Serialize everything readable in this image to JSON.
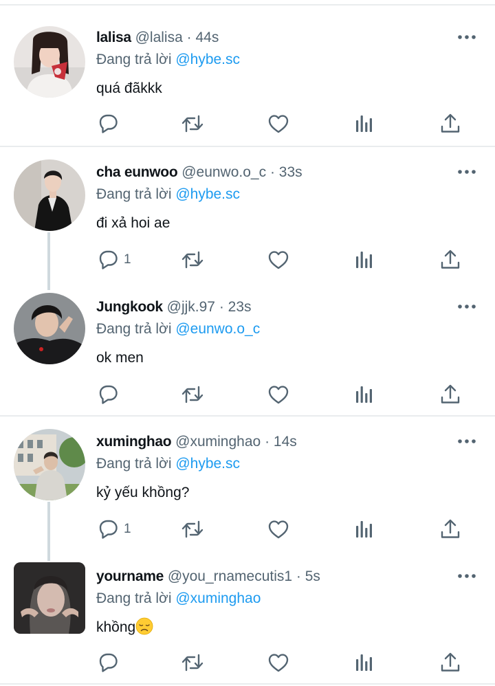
{
  "tweets": [
    {
      "name": "lalisa",
      "handle": "@lalisa",
      "time": "44s",
      "replying_prefix": "Đang trả lời",
      "replying_to": "@hybe.sc",
      "text": "quá đãkkk",
      "reply_count": ""
    },
    {
      "name": "cha eunwoo",
      "handle": "@eunwo.o_c",
      "time": "33s",
      "replying_prefix": "Đang trả lời",
      "replying_to": "@hybe.sc",
      "text": "đi xả hoi ae",
      "reply_count": "1"
    },
    {
      "name": "Jungkook",
      "handle": "@jjk.97",
      "time": "23s",
      "replying_prefix": "Đang trả lời",
      "replying_to": "@eunwo.o_c",
      "text": "ok men",
      "reply_count": ""
    },
    {
      "name": "xuminghao",
      "handle": "@xuminghao",
      "time": "14s",
      "replying_prefix": "Đang trả lời",
      "replying_to": "@hybe.sc",
      "text": "kỷ yếu khồng?",
      "reply_count": "1"
    },
    {
      "name": "yourname",
      "handle": "@you_rnamecutis1",
      "time": "5s",
      "replying_prefix": "Đang trả lời",
      "replying_to": "@xuminghao",
      "text": "khồng",
      "text_emoji": "disappointed-face-emoji",
      "reply_count": ""
    }
  ],
  "separator": "·",
  "icons": {
    "reply": "reply-icon",
    "retweet": "retweet-icon",
    "like": "like-icon",
    "views": "views-icon",
    "share": "share-icon",
    "more": "more-icon"
  },
  "colors": {
    "link": "#1d9bf0",
    "secondary_text": "#536471",
    "primary_text": "#0f1419",
    "thread_line": "#cfd9de"
  }
}
